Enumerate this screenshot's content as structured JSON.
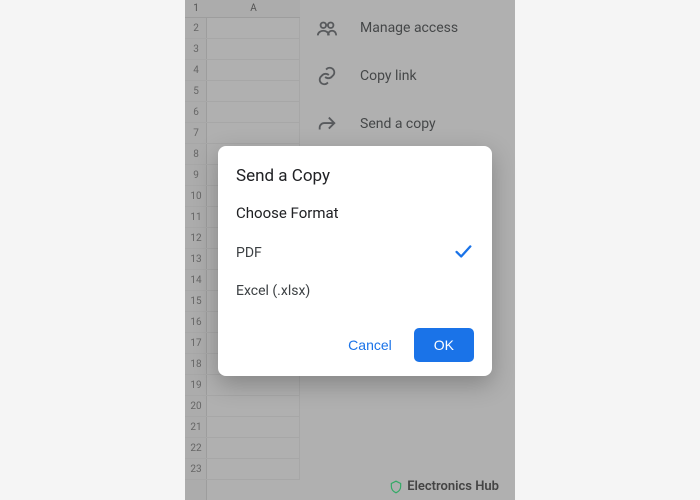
{
  "sheet": {
    "col_label": "A",
    "first_row_label": "1",
    "rows": [
      "2",
      "3",
      "4",
      "5",
      "6",
      "7",
      "8",
      "9",
      "10",
      "11",
      "12",
      "13",
      "14",
      "15",
      "16",
      "17",
      "18",
      "19",
      "20",
      "21",
      "22",
      "23"
    ]
  },
  "menu": {
    "items": [
      {
        "icon": "people-icon",
        "label": "Manage access"
      },
      {
        "icon": "link-icon",
        "label": "Copy link"
      },
      {
        "icon": "share-arrow-icon",
        "label": "Send a copy"
      }
    ]
  },
  "dialog": {
    "title": "Send a Copy",
    "subtitle": "Choose Format",
    "options": [
      {
        "label": "PDF",
        "selected": true
      },
      {
        "label": "Excel (.xlsx)",
        "selected": false
      }
    ],
    "cancel": "Cancel",
    "ok": "OK"
  },
  "watermark": {
    "text": "Electronics Hub"
  }
}
